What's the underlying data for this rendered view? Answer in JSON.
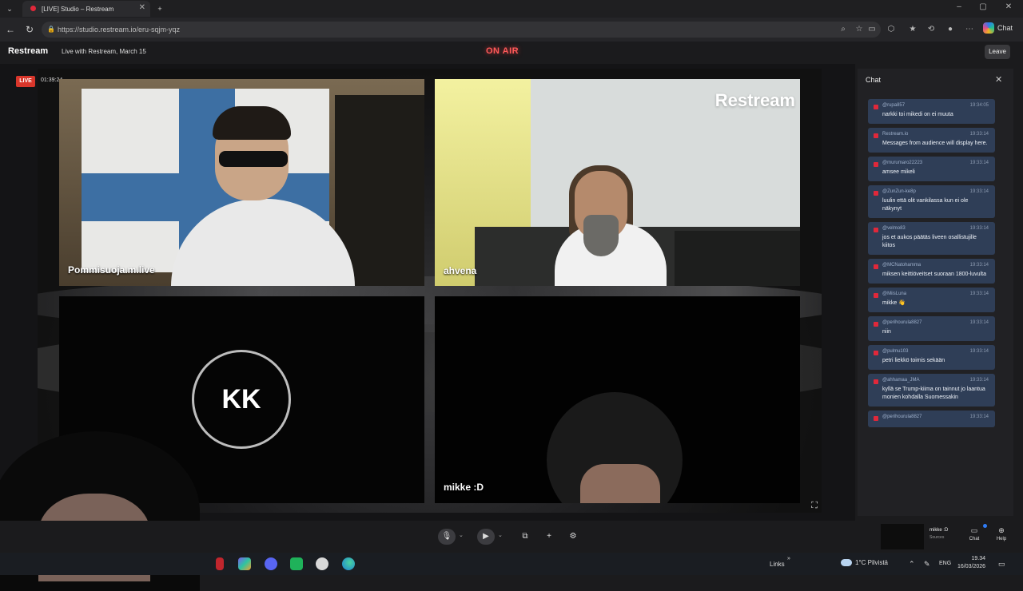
{
  "browser": {
    "tab_title": "[LIVE] Studio – Restream",
    "url": "https://studio.restream.io/eru-sqjm-yqz",
    "chat_extension_label": "Chat"
  },
  "header": {
    "brand": "Restream",
    "event_title": "Live with Restream, March 15",
    "on_air": "ON AIR",
    "leave_label": "Leave"
  },
  "stage": {
    "live_badge": "LIVE",
    "timer": "01:39:24",
    "watermark": "Restream",
    "tiles": [
      {
        "name": "Pommisuoja.m.live"
      },
      {
        "name": "ahvena"
      },
      {
        "name": "",
        "initials": "KK"
      },
      {
        "name": "mikke :D"
      }
    ]
  },
  "chat": {
    "title": "Chat",
    "messages": [
      {
        "user": "@rupa857",
        "time": "19:34:05",
        "text": "narkki toi mikedi on ei muuta"
      },
      {
        "user": "Restream.io",
        "time": "19:33:14",
        "text": "Messages from audience will display here."
      },
      {
        "user": "@murumaro22223",
        "time": "19:33:14",
        "text": "amsee mikeli"
      },
      {
        "user": "@ZunZun-ke8p",
        "time": "19:33:14",
        "text": "luulin että olit vankilassa kun ei ole näkynyt"
      },
      {
        "user": "@velmo83",
        "time": "19:33:14",
        "text": "jos et aukos päätäs liveen osallistujille kiitos"
      },
      {
        "user": "@MCNatohamma",
        "time": "19:33:14",
        "text": "miksen keittiöveitset suoraan 1800-luvulta"
      },
      {
        "user": "@MiisLuna",
        "time": "19:33:14",
        "text": "mikke 👋"
      },
      {
        "user": "@perihourula8827",
        "time": "19:33:14",
        "text": "niin"
      },
      {
        "user": "@pulmu103",
        "time": "19:33:14",
        "text": "petri liekkö toimis sekään"
      },
      {
        "user": "@ahhamaa_JMA",
        "time": "19:33:14",
        "text": "kyllä se Trump-kiima on tainnut jo laantua monien kohdalla Suomessakin"
      },
      {
        "user": "@perihourula8827",
        "time": "19:33:14",
        "text": ""
      }
    ]
  },
  "toolbar": {
    "preview_name": "mikke :D",
    "preview_sub": "Sources",
    "chat_label": "Chat",
    "help_label": "Help"
  },
  "taskbar": {
    "links": "Links",
    "weather": "1°C  Pilvistä",
    "lang": "ENG",
    "time": "19.34",
    "date": "16/03/2026"
  },
  "colors": {
    "accent_live": "#d9362b",
    "on_air": "#ff5a5a",
    "chat_bubble": "#2f3e57"
  }
}
